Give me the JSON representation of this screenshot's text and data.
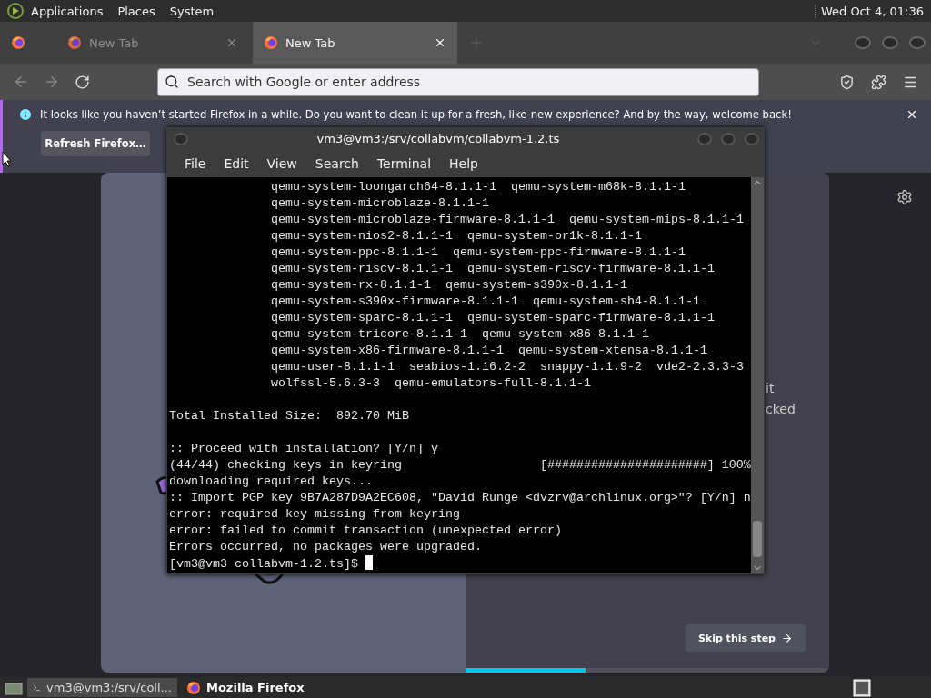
{
  "top_panel": {
    "menus": [
      "Applications",
      "Places",
      "System"
    ],
    "clock": "Wed Oct  4, 01:36"
  },
  "browser": {
    "tabs": [
      {
        "title": "New Tab",
        "selected": false
      },
      {
        "title": "New Tab",
        "selected": true
      }
    ],
    "address": {
      "placeholder": "Search with Google or enter address"
    },
    "notification": {
      "message": "It looks like you haven’t started Firefox in a while. Do you want to clean it up for a fresh, like-new experience? And by the way, welcome back!",
      "button": "Refresh Firefox…"
    },
    "onboarding": {
      "partial_texts": [
        "it",
        "cked"
      ],
      "skip_button": "Skip this step",
      "progress": {
        "level": 0.33
      }
    }
  },
  "terminal": {
    "title": "vm3@vm3:/srv/collabvm/collabvm-1.2.ts",
    "menus": [
      "File",
      "Edit",
      "View",
      "Search",
      "Terminal",
      "Help"
    ],
    "lines": [
      {
        "kind": "indented",
        "text": "qemu-system-loongarch64-8.1.1-1  qemu-system-m68k-8.1.1-1"
      },
      {
        "kind": "indented",
        "text": "qemu-system-microblaze-8.1.1-1"
      },
      {
        "kind": "indented",
        "text": "qemu-system-microblaze-firmware-8.1.1-1  qemu-system-mips-8.1.1-1"
      },
      {
        "kind": "indented",
        "text": "qemu-system-nios2-8.1.1-1  qemu-system-or1k-8.1.1-1"
      },
      {
        "kind": "indented",
        "text": "qemu-system-ppc-8.1.1-1  qemu-system-ppc-firmware-8.1.1-1"
      },
      {
        "kind": "indented",
        "text": "qemu-system-riscv-8.1.1-1  qemu-system-riscv-firmware-8.1.1-1"
      },
      {
        "kind": "indented",
        "text": "qemu-system-rx-8.1.1-1  qemu-system-s390x-8.1.1-1"
      },
      {
        "kind": "indented",
        "text": "qemu-system-s390x-firmware-8.1.1-1  qemu-system-sh4-8.1.1-1"
      },
      {
        "kind": "indented",
        "text": "qemu-system-sparc-8.1.1-1  qemu-system-sparc-firmware-8.1.1-1"
      },
      {
        "kind": "indented",
        "text": "qemu-system-tricore-8.1.1-1  qemu-system-x86-8.1.1-1"
      },
      {
        "kind": "indented",
        "text": "qemu-system-x86-firmware-8.1.1-1  qemu-system-xtensa-8.1.1-1"
      },
      {
        "kind": "indented",
        "text": "qemu-user-8.1.1-1  seabios-1.16.2-2  snappy-1.1.9-2  vde2-2.3.3-3"
      },
      {
        "kind": "indented",
        "text": "wolfssl-5.6.3-3  qemu-emulators-full-8.1.1-1"
      },
      {
        "kind": "blank"
      },
      {
        "kind": "plain",
        "text": "Total Installed Size:  892.70 MiB"
      },
      {
        "kind": "blank"
      },
      {
        "kind": "plain",
        "text": ":: Proceed with installation? [Y/n] y"
      },
      {
        "kind": "plain",
        "text": "(44/44) checking keys in keyring                   [######################] 100%"
      },
      {
        "kind": "plain",
        "text": "downloading required keys..."
      },
      {
        "kind": "plain",
        "text": ":: Import PGP key 9B7A287D9A2EC608, \"David Runge <dvzrv@archlinux.org>\"? [Y/n] n"
      },
      {
        "kind": "plain",
        "text": "error: required key missing from keyring"
      },
      {
        "kind": "plain",
        "text": "error: failed to commit transaction (unexpected error)"
      },
      {
        "kind": "plain",
        "text": "Errors occurred, no packages were upgraded."
      },
      {
        "kind": "prompt",
        "text": "[vm3@vm3 collabvm-1.2.ts]$ "
      }
    ]
  },
  "taskbar": {
    "items": [
      {
        "label": "vm3@vm3:/srv/coll...",
        "kind": "terminal",
        "selected": true
      },
      {
        "label": "Mozilla Firefox",
        "kind": "firefox",
        "selected": false
      }
    ]
  }
}
